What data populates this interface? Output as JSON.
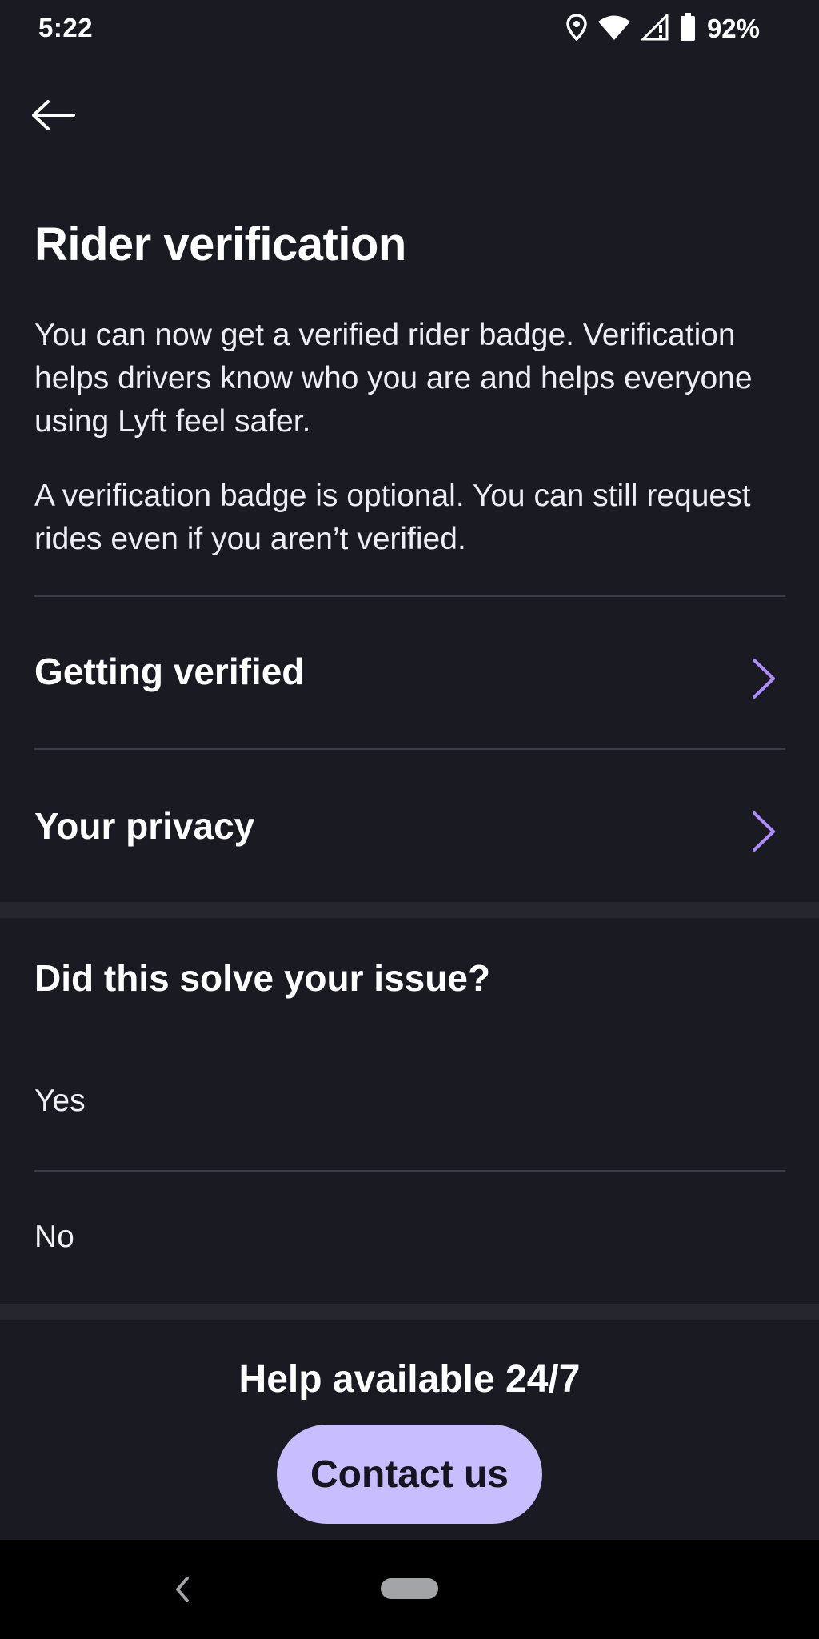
{
  "status_bar": {
    "time": "5:22",
    "battery_percent": "92%",
    "icons": [
      "location-icon",
      "wifi-icon",
      "signal-icon",
      "battery-icon"
    ]
  },
  "header": {
    "back_icon": "arrow-left-icon"
  },
  "page": {
    "title": "Rider verification",
    "paragraphs": [
      "You can now get a verified rider badge. Verification helps drivers know who you are and helps everyone using Lyft feel safer.",
      "A verification badge is optional. You can still request rides even if you aren’t verified."
    ]
  },
  "links": [
    {
      "label": "Getting verified",
      "icon": "chevron-right-icon"
    },
    {
      "label": "Your privacy",
      "icon": "chevron-right-icon"
    }
  ],
  "feedback": {
    "question": "Did this solve your issue?",
    "options": [
      "Yes",
      "No"
    ]
  },
  "help": {
    "title": "Help available 24/7",
    "contact_label": "Contact us"
  },
  "colors": {
    "background": "#1a1b22",
    "accent": "#b08cff",
    "button": "#c7bdff",
    "divider": "#3a3c46"
  }
}
